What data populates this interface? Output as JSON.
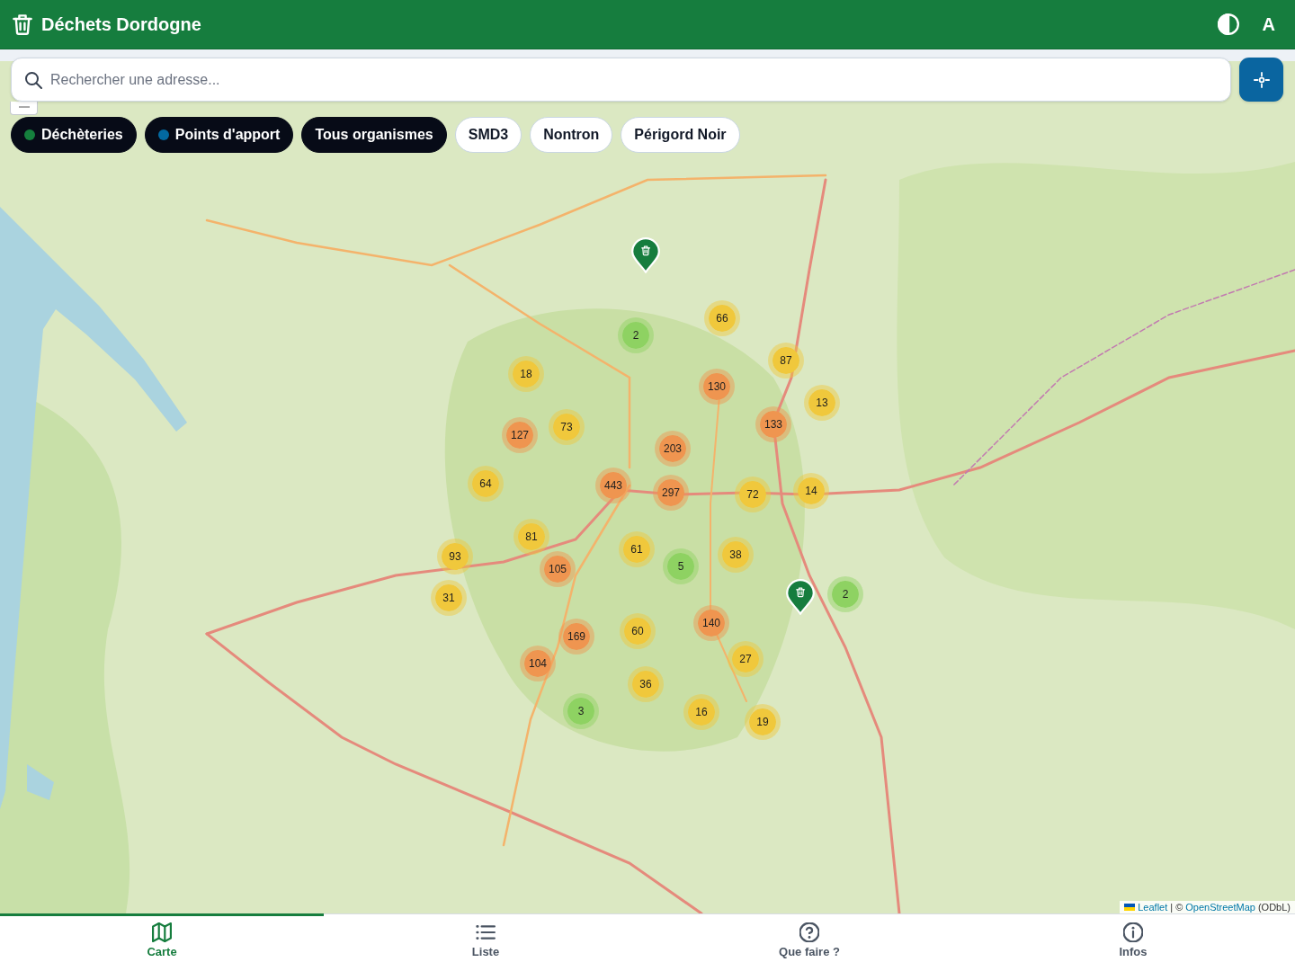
{
  "header": {
    "title": "Déchets Dordogne",
    "actions": [
      {
        "kind": "contrast"
      },
      {
        "kind": "text",
        "label": "A"
      }
    ]
  },
  "search": {
    "placeholder": "Rechercher une adresse...",
    "locate_button": true
  },
  "filters": [
    {
      "label": "Déchèteries",
      "selected": true,
      "color": "#15803d"
    },
    {
      "label": "Points d'apport",
      "selected": true,
      "color": "#0369a1"
    },
    {
      "label": "Tous organismes",
      "selected": true
    },
    {
      "label": "SMD3",
      "selected": false
    },
    {
      "label": "Nontron",
      "selected": false
    },
    {
      "label": "Périgord Noir",
      "selected": false
    }
  ],
  "map": {
    "zoom_control": true,
    "clusters": [
      {
        "count": "66",
        "color": "#f0c83c"
      },
      {
        "count": "2",
        "color": "#8ed262"
      },
      {
        "count": "18",
        "color": "#f0c83c"
      },
      {
        "count": "87",
        "color": "#f0c83c"
      },
      {
        "count": "130",
        "color": "#ef9550"
      },
      {
        "count": "13",
        "color": "#f0c83c"
      },
      {
        "count": "73",
        "color": "#f0c83c"
      },
      {
        "count": "127",
        "color": "#ef9550"
      },
      {
        "count": "133",
        "color": "#ef9550"
      },
      {
        "count": "203",
        "color": "#ef9550"
      },
      {
        "count": "64",
        "color": "#f0c83c"
      },
      {
        "count": "443",
        "color": "#ef9550"
      },
      {
        "count": "297",
        "color": "#ef9550"
      },
      {
        "count": "72",
        "color": "#f0c83c"
      },
      {
        "count": "14",
        "color": "#f0c83c"
      },
      {
        "count": "81",
        "color": "#f0c83c"
      },
      {
        "count": "93",
        "color": "#f0c83c"
      },
      {
        "count": "61",
        "color": "#f0c83c"
      },
      {
        "count": "5",
        "color": "#8ed262"
      },
      {
        "count": "38",
        "color": "#f0c83c"
      },
      {
        "count": "105",
        "color": "#ef9550"
      },
      {
        "count": "31",
        "color": "#f0c83c"
      },
      {
        "count": "2",
        "color": "#8ed262"
      },
      {
        "count": "140",
        "color": "#ef9550"
      },
      {
        "count": "60",
        "color": "#f0c83c"
      },
      {
        "count": "169",
        "color": "#ef9550"
      },
      {
        "count": "27",
        "color": "#f0c83c"
      },
      {
        "count": "104",
        "color": "#ef9550"
      },
      {
        "count": "36",
        "color": "#f0c83c"
      },
      {
        "count": "3",
        "color": "#8ed262"
      },
      {
        "count": "16",
        "color": "#f0c83c"
      },
      {
        "count": "19",
        "color": "#f0c83c"
      }
    ],
    "pins": [
      {
        "kind": "bin"
      },
      {
        "kind": "bin"
      }
    ],
    "attribution": {
      "flag": true,
      "library": "Leaflet",
      "separator": "| ©",
      "source": "OpenStreetMap",
      "license": "(ODbL)"
    }
  },
  "nav": [
    {
      "kind": "map",
      "label": "Carte",
      "selected": true
    },
    {
      "kind": "list",
      "label": "Liste",
      "selected": false
    },
    {
      "kind": "question",
      "label": "Que faire ?",
      "selected": false
    },
    {
      "kind": "info",
      "label": "Infos",
      "selected": false
    }
  ]
}
